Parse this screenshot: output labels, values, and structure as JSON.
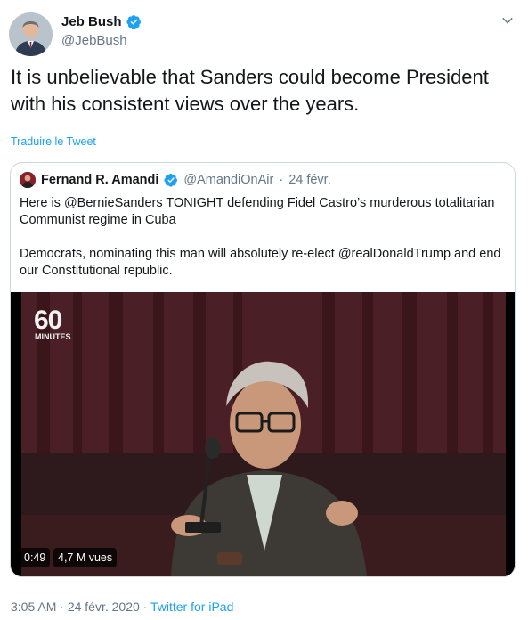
{
  "author": {
    "name": "Jeb Bush",
    "handle": "@JebBush",
    "verified": true
  },
  "tweet": {
    "text": "It is unbelievable that Sanders could become President with his consistent views over the years.",
    "translate_label": "Traduire le Tweet"
  },
  "quoted": {
    "name": "Fernand R. Amandi",
    "handle": "@AmandiOnAir",
    "separator": "·",
    "date": "24 févr.",
    "paragraph1": "Here is @BernieSanders TONIGHT defending Fidel Castro’s murderous totalitarian Communist regime in Cuba",
    "paragraph2": "Democrats, nominating this man will absolutely re-elect @realDonaldTrump and end our Constitutional republic.",
    "video": {
      "logo_number": "60",
      "logo_word": "MINUTES",
      "duration": "0:49",
      "views": "4,7 M vues"
    }
  },
  "footer": {
    "time": "3:05 AM",
    "sep1": "·",
    "date": "24 févr. 2020",
    "sep2": "·",
    "source": "Twitter for iPad"
  },
  "colors": {
    "link": "#1da1f2",
    "muted": "#657786",
    "border": "#ccd6dd"
  },
  "icons": [
    "verified-icon",
    "chevron-down-icon"
  ]
}
